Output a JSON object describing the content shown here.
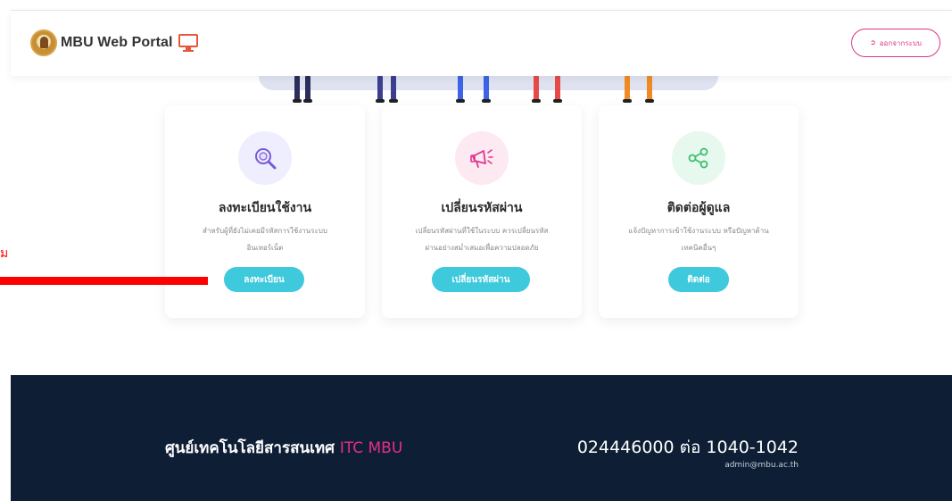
{
  "header": {
    "brand": "MBU Web Portal",
    "logout_label": "ออกจากระบบ",
    "accent_color": "#e0338a"
  },
  "cards": [
    {
      "title": "ลงทะเบียนใช้งาน",
      "desc_line1": "สำหรับผู้ที่ยังไม่เคยมีรหัสการใช้งานระบบ",
      "desc_line2": "อินเทอร์เน็ต",
      "button": "ลงทะเบียน",
      "icon": "magnifier-icon"
    },
    {
      "title": "เปลี่ยนรหัสผ่าน",
      "desc_line1": "เปลี่ยนรหัสผ่านที่ใช้ในระบบ ควรเปลี่ยนรหัส",
      "desc_line2": "ผ่านอย่างสม่ำเสมอเพื่อความปลอดภัย",
      "button": "เปลี่ยนรหัสผ่าน",
      "icon": "megaphone-icon"
    },
    {
      "title": "ติดต่อผู้ดูแล",
      "desc_line1": "แจ้งปัญหาการเข้าใช้งานระบบ หรือปัญหาด้าน",
      "desc_line2": "เทคนิคอื่นๆ",
      "button": "ติดต่อ",
      "icon": "share-icon"
    }
  ],
  "annotation": {
    "mark": "ม"
  },
  "footer": {
    "center_name": "ศูนย์เทคโนโลยีสารสนเทศ",
    "center_accent": "ITC MBU",
    "phone": "024446000 ต่อ 1040-1042",
    "email": "admin@mbu.ac.th"
  },
  "colors": {
    "button": "#3fc9dc",
    "footer_bg": "#0e1f35",
    "accent": "#e62c8a"
  }
}
